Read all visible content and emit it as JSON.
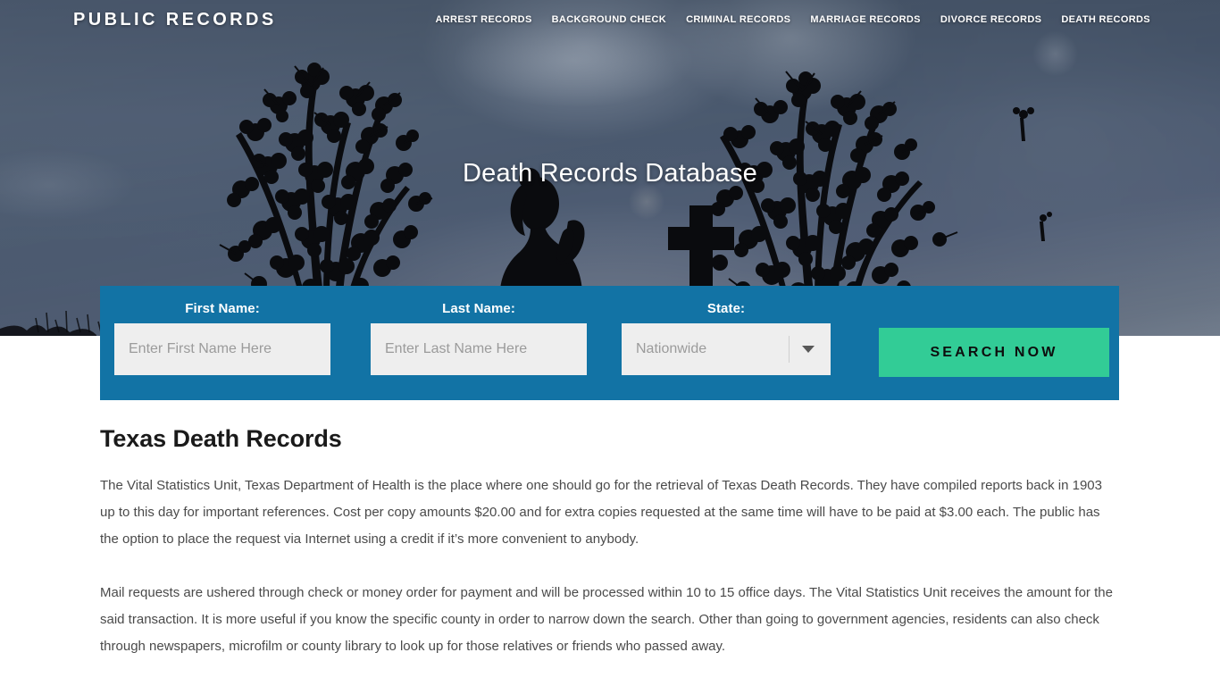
{
  "header": {
    "logo": "PUBLIC RECORDS",
    "nav": [
      {
        "label": "ARREST RECORDS"
      },
      {
        "label": "BACKGROUND CHECK"
      },
      {
        "label": "CRIMINAL RECORDS"
      },
      {
        "label": "MARRIAGE RECORDS"
      },
      {
        "label": "DIVORCE RECORDS"
      },
      {
        "label": "DEATH RECORDS"
      }
    ]
  },
  "hero": {
    "title": "Death Records Database"
  },
  "search": {
    "first_name": {
      "label": "First Name:",
      "placeholder": "Enter First Name Here",
      "value": ""
    },
    "last_name": {
      "label": "Last Name:",
      "placeholder": "Enter Last Name Here",
      "value": ""
    },
    "state": {
      "label": "State:",
      "selected": "Nationwide"
    },
    "submit_label": "SEARCH NOW"
  },
  "main": {
    "title": "Texas Death Records",
    "paragraphs": [
      "The Vital Statistics Unit, Texas Department of Health is the place where one should go for the retrieval of Texas Death Records. They have compiled reports back in 1903 up to this day for important references. Cost per copy amounts $20.00 and for extra copies requested at the same time will have to be paid at $3.00 each. The public has the option to place the request via Internet using a credit if it’s more convenient to anybody.",
      "Mail requests are ushered through check or money order for payment and will be processed within 10 to 15 office days. The Vital Statistics Unit receives the amount for the said transaction. It is more useful if you know the specific county in order to narrow down the search. Other than going to government agencies, residents can also check through newspapers, microfilm or county library to look up for those relatives or friends who passed away."
    ]
  },
  "colors": {
    "form_blue": "#1273a5",
    "button_green": "#32cc96",
    "input_grey": "#eeeeee",
    "hero_sky": "#566578",
    "heading_dark": "#1a1a1a",
    "body_text": "#4a4a4a"
  }
}
